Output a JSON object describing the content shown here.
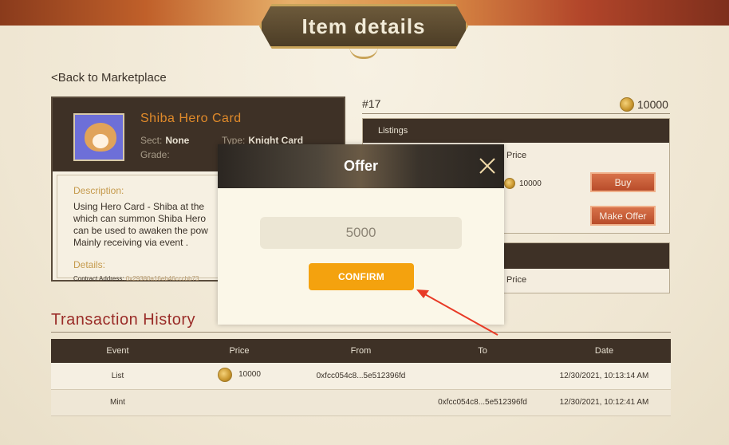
{
  "header": {
    "title": "Item details"
  },
  "nav": {
    "back_label": "Back to Marketplace"
  },
  "card": {
    "name": "Shiba Hero Card",
    "sect_label": "Sect:",
    "sect_value": "None",
    "type_label": "Type:",
    "type_value": "Knight Card",
    "grade_label": "Grade:",
    "description_label": "Description:",
    "description_lines": [
      "Using Hero Card - Shiba at the",
      "which can summon Shiba Hero",
      "can be used to awaken the pow",
      "Mainly receiving via event ."
    ],
    "details_label": "Details:",
    "contract_label": "Contract Address:",
    "contract_value": "0x29380a16eb46cccbb73"
  },
  "listing": {
    "token_id": "#17",
    "price": "10000",
    "panel_title": "Listings",
    "price_col": "Price",
    "row_price": "10000",
    "buy_label": "Buy",
    "make_offer_label": "Make Offer"
  },
  "offers": {
    "price_col": "Price"
  },
  "history": {
    "title": "Transaction History",
    "columns": [
      "Event",
      "Price",
      "From",
      "To",
      "Date"
    ],
    "rows": [
      {
        "event": "List",
        "price": "10000",
        "from": "0xfcc054c8...5e512396fd",
        "to": "",
        "date": "12/30/2021, 10:13:14 AM"
      },
      {
        "event": "Mint",
        "price": "",
        "from": "",
        "to": "0xfcc054c8...5e512396fd",
        "date": "12/30/2021, 10:12:41 AM"
      }
    ]
  },
  "modal": {
    "title": "Offer",
    "input_value": "5000",
    "confirm_label": "CONFIRM"
  },
  "colors": {
    "accent": "#f4a20e",
    "header_dark": "#3e3126",
    "history_title": "#9a2c28",
    "annotation_arrow": "#e83a26"
  },
  "icons": {
    "coin": "gold-coin-icon",
    "close": "close-icon",
    "back": "chevron-left-icon"
  }
}
